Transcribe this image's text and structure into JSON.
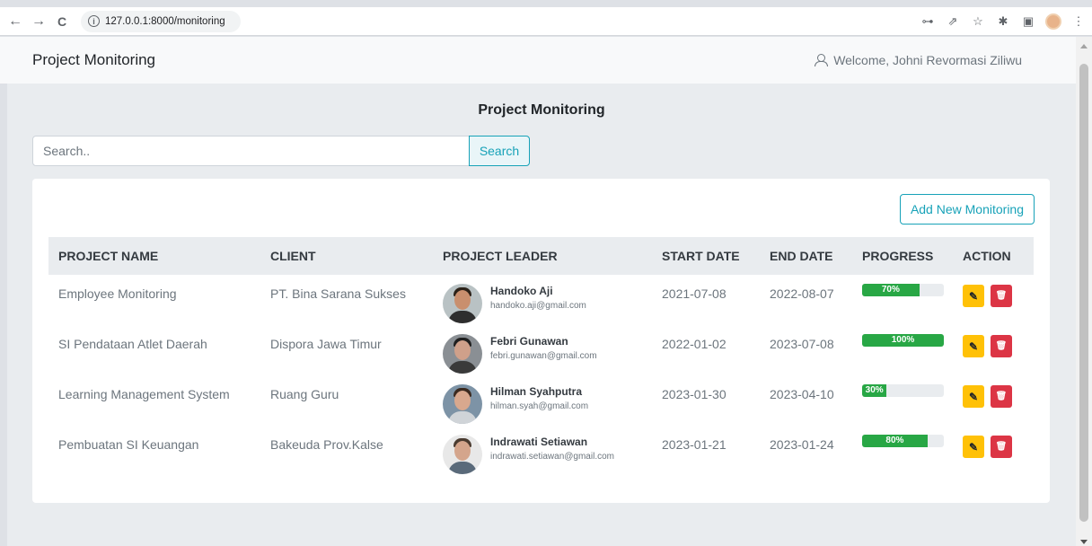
{
  "browser": {
    "url": "127.0.0.1:8000/monitoring",
    "back": "←",
    "forward": "→",
    "reload": "C",
    "info": "i",
    "key": "⊶",
    "share": "⇗",
    "star": "☆",
    "extensions": "✱",
    "sidepanel": "▣",
    "menu": "⋮"
  },
  "header": {
    "brand": "Project Monitoring",
    "welcome": "Welcome, Johni Revormasi Ziliwu"
  },
  "page": {
    "title": "Project Monitoring",
    "search_placeholder": "Search..",
    "search_button": "Search",
    "add_button": "Add New Monitoring"
  },
  "table": {
    "columns": [
      "PROJECT NAME",
      "CLIENT",
      "PROJECT LEADER",
      "START DATE",
      "END DATE",
      "PROGRESS",
      "ACTION"
    ],
    "rows": [
      {
        "project": "Employee Monitoring",
        "client": "PT. Bina Sarana Sukses",
        "leader": "Handoko Aji",
        "email": "handoko.aji@gmail.com",
        "start": "2021-07-08",
        "end": "2022-08-07",
        "progress": 70,
        "progress_label": "70%"
      },
      {
        "project": "SI Pendataan Atlet Daerah",
        "client": "Dispora Jawa Timur",
        "leader": "Febri Gunawan",
        "email": "febri.gunawan@gmail.com",
        "start": "2022-01-02",
        "end": "2023-07-08",
        "progress": 100,
        "progress_label": "100%"
      },
      {
        "project": "Learning Management System",
        "client": "Ruang Guru",
        "leader": "Hilman Syahputra",
        "email": "hilman.syah@gmail.com",
        "start": "2023-01-30",
        "end": "2023-04-10",
        "progress": 30,
        "progress_label": "30%"
      },
      {
        "project": "Pembuatan SI Keuangan",
        "client": "Bakeuda Prov.Kalse",
        "leader": "Indrawati Setiawan",
        "email": "indrawati.setiawan@gmail.com",
        "start": "2023-01-21",
        "end": "2023-01-24",
        "progress": 80,
        "progress_label": "80%"
      }
    ],
    "edit_icon": "✎",
    "delete_icon": "🗑"
  },
  "colors": {
    "accent": "#17a2b8",
    "progress": "#28a745",
    "edit": "#ffc107",
    "delete": "#dc3545"
  }
}
